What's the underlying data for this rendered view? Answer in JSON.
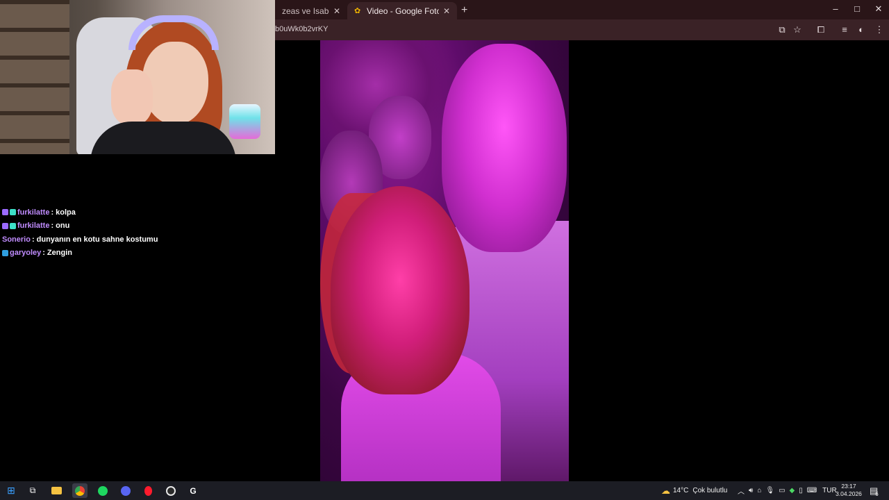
{
  "browser": {
    "tabs": [
      {
        "label": "zeas ve Isabella: Aşk ve",
        "active": false
      },
      {
        "label": "Video - Google Fotoğraflar",
        "active": true
      }
    ],
    "new_tab_label": "+",
    "url": "b0uWk0b2vrKY",
    "window_controls": {
      "minimize": "–",
      "maximize": "□",
      "close": "✕"
    }
  },
  "chat": {
    "messages": [
      {
        "user": "furkilatte",
        "sep": ":",
        "text": "kolpa",
        "badges": [
          "#9b6bff",
          "#3de0c8"
        ]
      },
      {
        "user": "furkilatte",
        "sep": ":",
        "text": "onu",
        "badges": [
          "#9b6bff",
          "#3de0c8"
        ]
      },
      {
        "user": "Sonerio",
        "sep": ":",
        "text": "dunyanın en kotu sahne kostumu",
        "badges": []
      },
      {
        "user": "garyoley",
        "sep": ":",
        "text": "Zengin",
        "badges": [
          "#2f9fe0"
        ]
      }
    ]
  },
  "taskbar": {
    "weather": {
      "temp": "14°C",
      "desc": "Çok bulutlu"
    },
    "language": "TUR",
    "time": "23:17",
    "date": "3.04.2026",
    "notification_count": "6",
    "apps": [
      {
        "name": "start",
        "color": "#3aa0ff"
      },
      {
        "name": "task-view",
        "color": "#ffffff"
      },
      {
        "name": "file-explorer",
        "color": "#f5c242"
      },
      {
        "name": "chrome",
        "color": "#4285f4"
      },
      {
        "name": "spotify",
        "color": "#1ed760"
      },
      {
        "name": "discord",
        "color": "#5865f2"
      },
      {
        "name": "opera",
        "color": "#ff1b2d"
      },
      {
        "name": "obs",
        "color": "#e8e8e8"
      },
      {
        "name": "logitech",
        "color": "#ffffff"
      }
    ]
  },
  "colors": {
    "chrome_bg": "#2a1518",
    "chat_user": "#c08cff",
    "taskbar_bg": "#1c1d24"
  }
}
